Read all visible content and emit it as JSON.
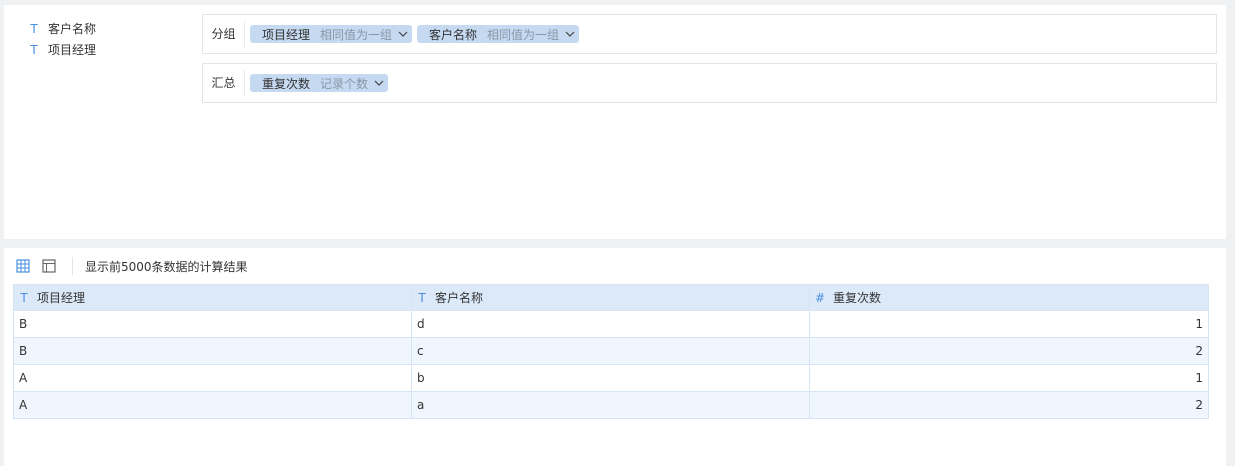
{
  "fields": [
    {
      "icon": "T",
      "label": "客户名称"
    },
    {
      "icon": "T",
      "label": "项目经理"
    }
  ],
  "group": {
    "title": "分组",
    "chips": [
      {
        "name": "项目经理",
        "agg": "相同值为一组"
      },
      {
        "name": "客户名称",
        "agg": "相同值为一组"
      }
    ]
  },
  "summary": {
    "title": "汇总",
    "chips": [
      {
        "name": "重复次数",
        "agg": "记录个数"
      }
    ]
  },
  "toolbar": {
    "info_text": "显示前5000条数据的计算结果"
  },
  "table": {
    "columns": [
      {
        "icon": "T",
        "label": "项目经理"
      },
      {
        "icon": "T",
        "label": "客户名称"
      },
      {
        "icon": "#",
        "label": "重复次数"
      }
    ],
    "rows": [
      [
        "B",
        "d",
        "1"
      ],
      [
        "B",
        "c",
        "2"
      ],
      [
        "A",
        "b",
        "1"
      ],
      [
        "A",
        "a",
        "2"
      ]
    ]
  },
  "colors": {
    "accent": "#4a8fe0",
    "chip_bg": "#c5d9f1",
    "header_bg": "#dbe9f9"
  }
}
